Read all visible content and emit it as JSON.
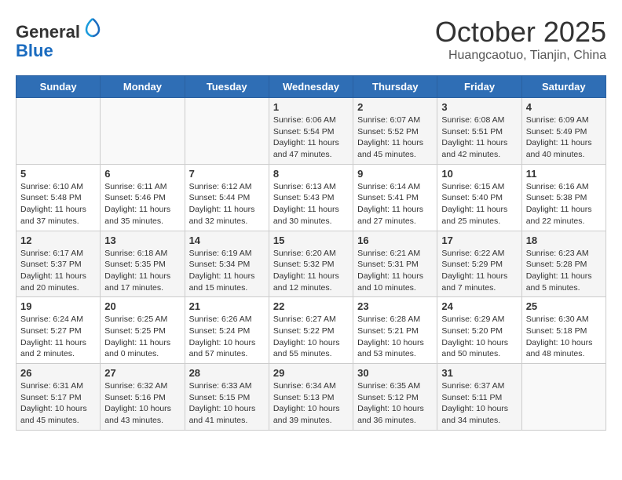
{
  "header": {
    "logo_line1": "General",
    "logo_line2": "Blue",
    "month_title": "October 2025",
    "location": "Huangcaotuo, Tianjin, China"
  },
  "weekdays": [
    "Sunday",
    "Monday",
    "Tuesday",
    "Wednesday",
    "Thursday",
    "Friday",
    "Saturday"
  ],
  "weeks": [
    [
      {
        "day": "",
        "content": ""
      },
      {
        "day": "",
        "content": ""
      },
      {
        "day": "",
        "content": ""
      },
      {
        "day": "1",
        "content": "Sunrise: 6:06 AM\nSunset: 5:54 PM\nDaylight: 11 hours and 47 minutes."
      },
      {
        "day": "2",
        "content": "Sunrise: 6:07 AM\nSunset: 5:52 PM\nDaylight: 11 hours and 45 minutes."
      },
      {
        "day": "3",
        "content": "Sunrise: 6:08 AM\nSunset: 5:51 PM\nDaylight: 11 hours and 42 minutes."
      },
      {
        "day": "4",
        "content": "Sunrise: 6:09 AM\nSunset: 5:49 PM\nDaylight: 11 hours and 40 minutes."
      }
    ],
    [
      {
        "day": "5",
        "content": "Sunrise: 6:10 AM\nSunset: 5:48 PM\nDaylight: 11 hours and 37 minutes."
      },
      {
        "day": "6",
        "content": "Sunrise: 6:11 AM\nSunset: 5:46 PM\nDaylight: 11 hours and 35 minutes."
      },
      {
        "day": "7",
        "content": "Sunrise: 6:12 AM\nSunset: 5:44 PM\nDaylight: 11 hours and 32 minutes."
      },
      {
        "day": "8",
        "content": "Sunrise: 6:13 AM\nSunset: 5:43 PM\nDaylight: 11 hours and 30 minutes."
      },
      {
        "day": "9",
        "content": "Sunrise: 6:14 AM\nSunset: 5:41 PM\nDaylight: 11 hours and 27 minutes."
      },
      {
        "day": "10",
        "content": "Sunrise: 6:15 AM\nSunset: 5:40 PM\nDaylight: 11 hours and 25 minutes."
      },
      {
        "day": "11",
        "content": "Sunrise: 6:16 AM\nSunset: 5:38 PM\nDaylight: 11 hours and 22 minutes."
      }
    ],
    [
      {
        "day": "12",
        "content": "Sunrise: 6:17 AM\nSunset: 5:37 PM\nDaylight: 11 hours and 20 minutes."
      },
      {
        "day": "13",
        "content": "Sunrise: 6:18 AM\nSunset: 5:35 PM\nDaylight: 11 hours and 17 minutes."
      },
      {
        "day": "14",
        "content": "Sunrise: 6:19 AM\nSunset: 5:34 PM\nDaylight: 11 hours and 15 minutes."
      },
      {
        "day": "15",
        "content": "Sunrise: 6:20 AM\nSunset: 5:32 PM\nDaylight: 11 hours and 12 minutes."
      },
      {
        "day": "16",
        "content": "Sunrise: 6:21 AM\nSunset: 5:31 PM\nDaylight: 11 hours and 10 minutes."
      },
      {
        "day": "17",
        "content": "Sunrise: 6:22 AM\nSunset: 5:29 PM\nDaylight: 11 hours and 7 minutes."
      },
      {
        "day": "18",
        "content": "Sunrise: 6:23 AM\nSunset: 5:28 PM\nDaylight: 11 hours and 5 minutes."
      }
    ],
    [
      {
        "day": "19",
        "content": "Sunrise: 6:24 AM\nSunset: 5:27 PM\nDaylight: 11 hours and 2 minutes."
      },
      {
        "day": "20",
        "content": "Sunrise: 6:25 AM\nSunset: 5:25 PM\nDaylight: 11 hours and 0 minutes."
      },
      {
        "day": "21",
        "content": "Sunrise: 6:26 AM\nSunset: 5:24 PM\nDaylight: 10 hours and 57 minutes."
      },
      {
        "day": "22",
        "content": "Sunrise: 6:27 AM\nSunset: 5:22 PM\nDaylight: 10 hours and 55 minutes."
      },
      {
        "day": "23",
        "content": "Sunrise: 6:28 AM\nSunset: 5:21 PM\nDaylight: 10 hours and 53 minutes."
      },
      {
        "day": "24",
        "content": "Sunrise: 6:29 AM\nSunset: 5:20 PM\nDaylight: 10 hours and 50 minutes."
      },
      {
        "day": "25",
        "content": "Sunrise: 6:30 AM\nSunset: 5:18 PM\nDaylight: 10 hours and 48 minutes."
      }
    ],
    [
      {
        "day": "26",
        "content": "Sunrise: 6:31 AM\nSunset: 5:17 PM\nDaylight: 10 hours and 45 minutes."
      },
      {
        "day": "27",
        "content": "Sunrise: 6:32 AM\nSunset: 5:16 PM\nDaylight: 10 hours and 43 minutes."
      },
      {
        "day": "28",
        "content": "Sunrise: 6:33 AM\nSunset: 5:15 PM\nDaylight: 10 hours and 41 minutes."
      },
      {
        "day": "29",
        "content": "Sunrise: 6:34 AM\nSunset: 5:13 PM\nDaylight: 10 hours and 39 minutes."
      },
      {
        "day": "30",
        "content": "Sunrise: 6:35 AM\nSunset: 5:12 PM\nDaylight: 10 hours and 36 minutes."
      },
      {
        "day": "31",
        "content": "Sunrise: 6:37 AM\nSunset: 5:11 PM\nDaylight: 10 hours and 34 minutes."
      },
      {
        "day": "",
        "content": ""
      }
    ]
  ]
}
